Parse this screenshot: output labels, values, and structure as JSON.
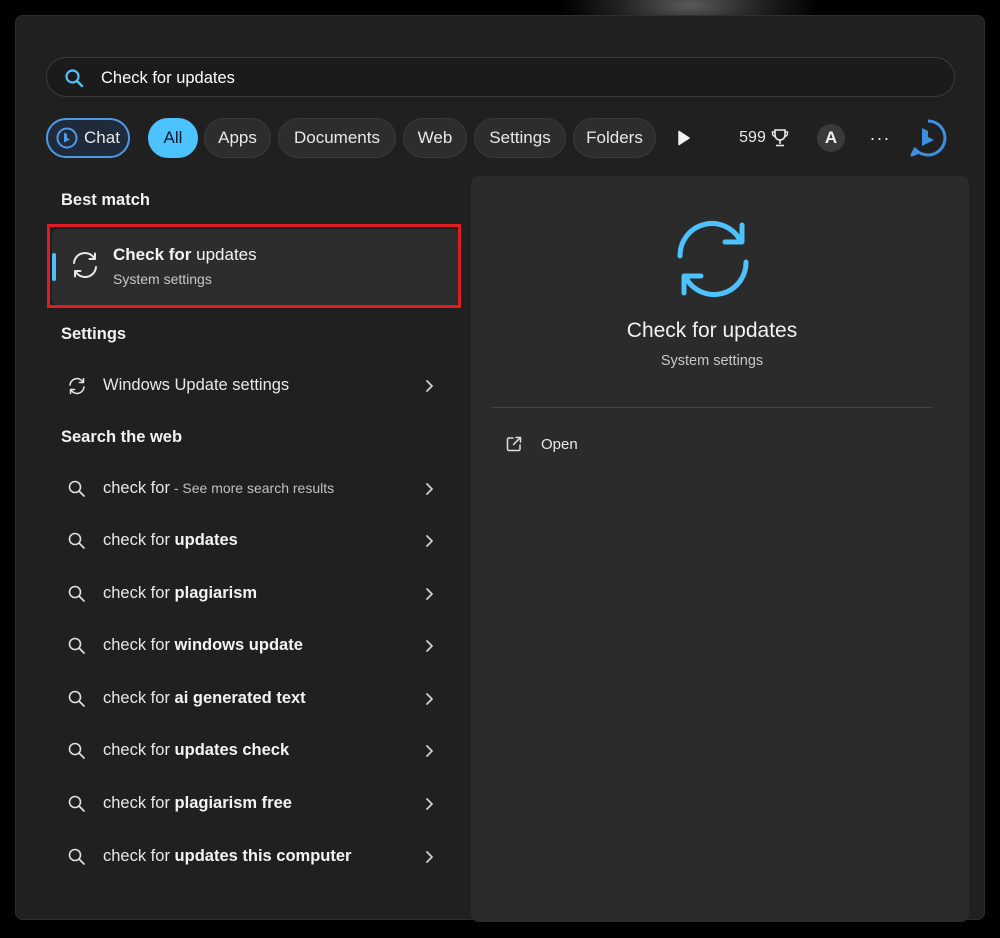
{
  "search": {
    "value": "Check for updates"
  },
  "filters": {
    "chips": [
      "Chat",
      "All",
      "Apps",
      "Documents",
      "Web",
      "Settings",
      "Folders"
    ],
    "points": "599",
    "avatar_letter": "A",
    "more_label": "···"
  },
  "best_match": {
    "heading": "Best match",
    "title_bold": "Check for",
    "title_rest": " updates",
    "subtitle": "System settings"
  },
  "settings": {
    "heading": "Settings",
    "item": "Windows Update settings"
  },
  "web": {
    "heading": "Search the web",
    "items": [
      {
        "prefix": "check for",
        "bold": "",
        "suffix": " - See more search results"
      },
      {
        "prefix": "check for ",
        "bold": "updates",
        "suffix": ""
      },
      {
        "prefix": "check for ",
        "bold": "plagiarism",
        "suffix": ""
      },
      {
        "prefix": "check for ",
        "bold": "windows update",
        "suffix": ""
      },
      {
        "prefix": "check for ",
        "bold": "ai generated text",
        "suffix": ""
      },
      {
        "prefix": "check for ",
        "bold": "updates check",
        "suffix": ""
      },
      {
        "prefix": "check for ",
        "bold": "plagiarism free",
        "suffix": ""
      },
      {
        "prefix": "check for ",
        "bold": "updates this computer",
        "suffix": ""
      }
    ]
  },
  "preview": {
    "title": "Check for updates",
    "subtitle": "System settings",
    "open_label": "Open"
  },
  "colors": {
    "accent": "#4cc2ff",
    "highlight_outline": "#e01b24",
    "panel_bg": "#202020",
    "preview_bg": "#2b2b2b"
  }
}
